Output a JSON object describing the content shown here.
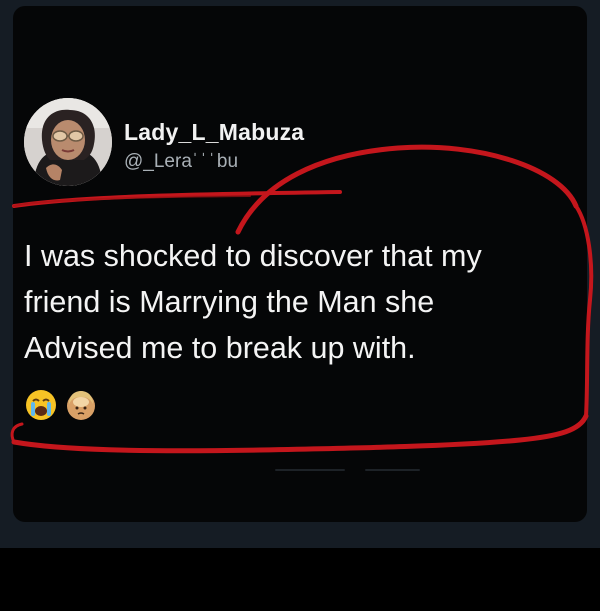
{
  "tweet": {
    "display_name": "Lady_L_Mabuza",
    "handle": "@_Lera",
    "handle_hidden_part": "bu",
    "text_lines": [
      "I was shocked to discover that my",
      "friend is Marrying the Man she",
      "Advised me to break up with."
    ],
    "emojis": [
      "crying-face-icon",
      "person-face-palm-icon"
    ]
  },
  "colors": {
    "background": "#151c24",
    "card": "#050607",
    "text": "#f4f4f4",
    "handle": "#a9b0b6",
    "annotation": "#c4161c"
  }
}
